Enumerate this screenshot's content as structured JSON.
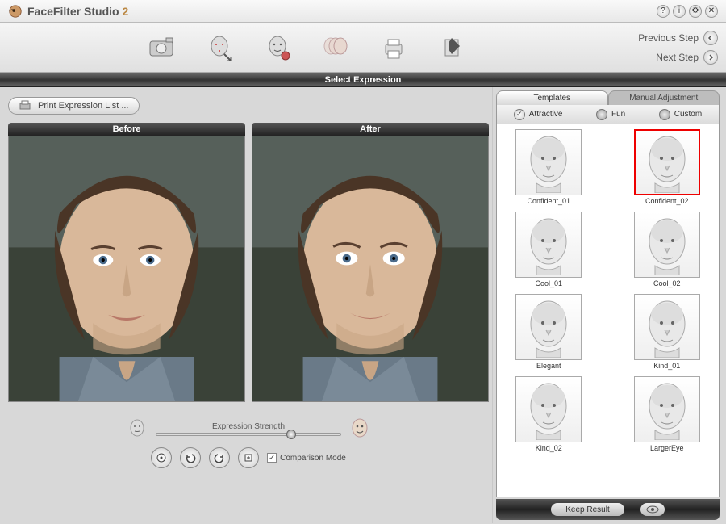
{
  "app": {
    "name": "FaceFilter Studio",
    "version": "2"
  },
  "titlebar_icons": [
    "help",
    "info",
    "settings",
    "close"
  ],
  "nav": {
    "prev": "Previous Step",
    "next": "Next Step"
  },
  "section_title": "Select Expression",
  "print_btn": "Print Expression List ...",
  "before_label": "Before",
  "after_label": "After",
  "strength_label": "Expression Strength",
  "strength_value_pct": 74,
  "comparison_label": "Comparison Mode",
  "comparison_checked": true,
  "tabs": {
    "templates": "Templates",
    "manual": "Manual Adjustment",
    "active": "templates"
  },
  "categories": [
    {
      "id": "attractive",
      "label": "Attractive",
      "selected": true
    },
    {
      "id": "fun",
      "label": "Fun",
      "selected": false
    },
    {
      "id": "custom",
      "label": "Custom",
      "selected": false
    }
  ],
  "templates": [
    {
      "id": "Confident_01",
      "label": "Confident_01",
      "selected": false
    },
    {
      "id": "Confident_02",
      "label": "Confident_02",
      "selected": true
    },
    {
      "id": "Cool_01",
      "label": "Cool_01",
      "selected": false
    },
    {
      "id": "Cool_02",
      "label": "Cool_02",
      "selected": false
    },
    {
      "id": "Elegant",
      "label": "Elegant",
      "selected": false
    },
    {
      "id": "Kind_01",
      "label": "Kind_01",
      "selected": false
    },
    {
      "id": "Kind_02",
      "label": "Kind_02",
      "selected": false
    },
    {
      "id": "LargerEye",
      "label": "LargerEye",
      "selected": false
    }
  ],
  "keep_label": "Keep Result",
  "toolbar_tools": [
    "camera",
    "face-points",
    "skin-tone",
    "expression",
    "print",
    "export"
  ]
}
